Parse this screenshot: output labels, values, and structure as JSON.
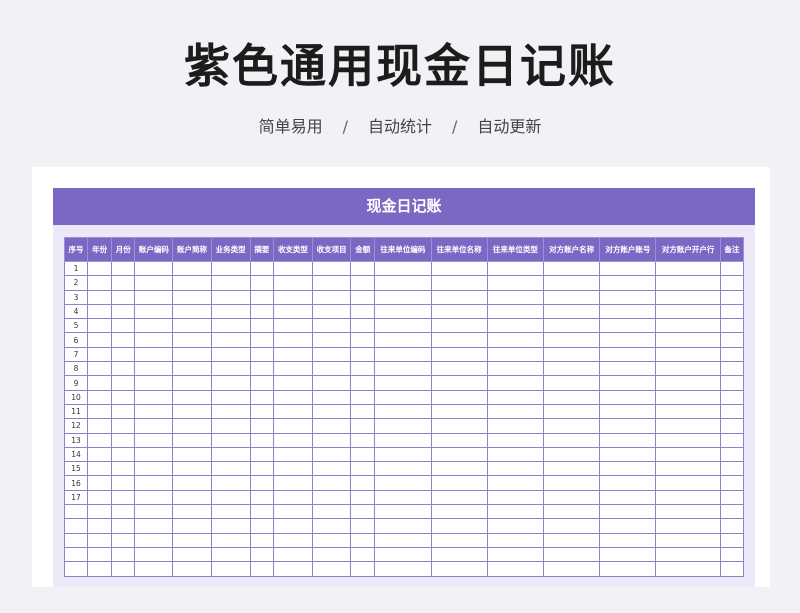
{
  "title": "紫色通用现金日记账",
  "subtitle": {
    "items": [
      "简单易用",
      "自动统计",
      "自动更新"
    ],
    "separator": "/"
  },
  "sheet": {
    "banner": "现金日记账",
    "headers": [
      "序号",
      "年份",
      "月份",
      "账户编码",
      "账户简称",
      "业务类型",
      "摘要",
      "收支类型",
      "收支项目",
      "金额",
      "往来单位编码",
      "往来单位名称",
      "往来单位类型",
      "对方账户名称",
      "对方账户账号",
      "对方账户开户行",
      "备注"
    ],
    "rows": [
      "1",
      "2",
      "3",
      "4",
      "5",
      "6",
      "7",
      "8",
      "9",
      "10",
      "11",
      "12",
      "13",
      "14",
      "15",
      "16",
      "17",
      "",
      "",
      "",
      "",
      ""
    ]
  },
  "colors": {
    "accent": "#7b67c4",
    "panel": "#ece8f8",
    "background": "#f1f2f6"
  }
}
